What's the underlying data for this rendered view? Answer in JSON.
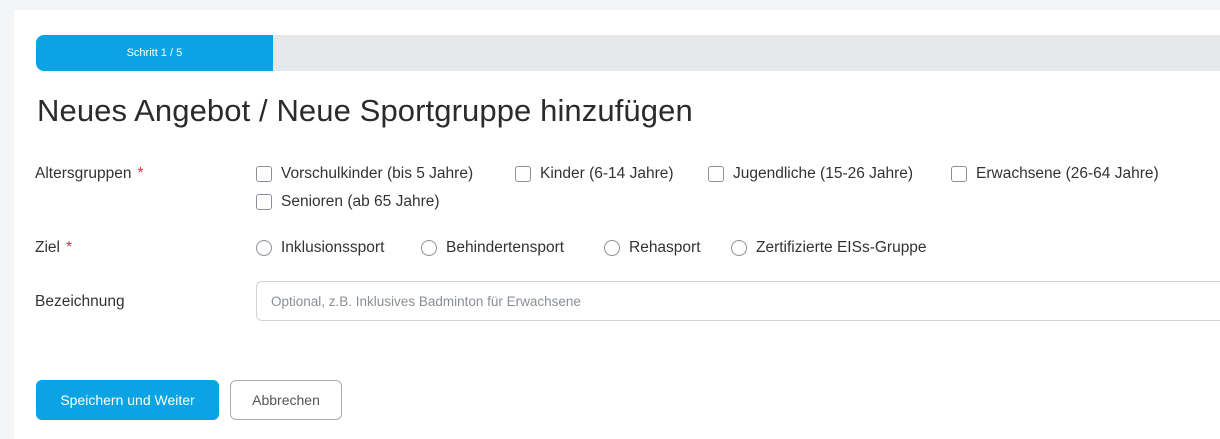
{
  "progress": {
    "label": "Schritt 1 / 5",
    "fraction": 0.2,
    "color": "#0aa3e3"
  },
  "page_title": "Neues Angebot / Neue Sportgruppe hinzufügen",
  "form": {
    "altersgruppen": {
      "label": "Altersgruppen",
      "required_marker": "*",
      "options": [
        "Vorschulkinder (bis 5 Jahre)",
        "Kinder (6-14 Jahre)",
        "Jugendliche (15-26 Jahre)",
        "Erwachsene (26-64 Jahre)",
        "Senioren (ab 65 Jahre)"
      ]
    },
    "ziel": {
      "label": "Ziel",
      "required_marker": "*",
      "options": [
        "Inklusionssport",
        "Behindertensport",
        "Rehasport",
        "Zertifizierte EISs-Gruppe"
      ]
    },
    "bezeichnung": {
      "label": "Bezeichnung",
      "value": "",
      "placeholder": "Optional, z.B. Inklusives Badminton für Erwachsene"
    }
  },
  "actions": {
    "save_label": "Speichern und Weiter",
    "cancel_label": "Abbrechen"
  },
  "colors": {
    "accent": "#0aa3e3",
    "required": "#e0283b"
  }
}
